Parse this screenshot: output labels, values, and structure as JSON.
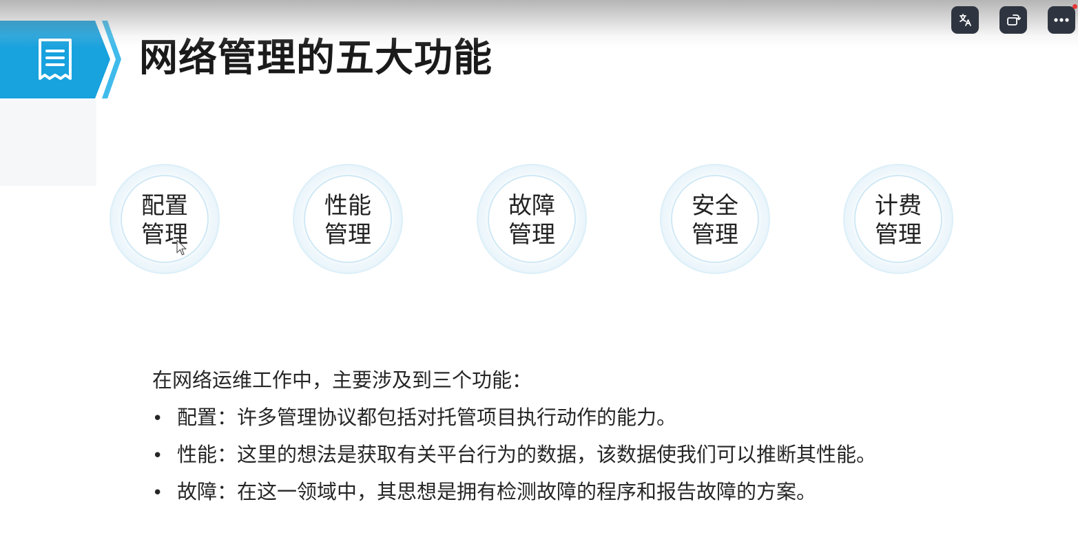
{
  "slide": {
    "title": "网络管理的五大功能",
    "banner_icon": "document-icon",
    "functions": [
      {
        "line1": "配置",
        "line2": "管理"
      },
      {
        "line1": "性能",
        "line2": "管理"
      },
      {
        "line1": "故障",
        "line2": "管理"
      },
      {
        "line1": "安全",
        "line2": "管理"
      },
      {
        "line1": "计费",
        "line2": "管理"
      }
    ],
    "intro": "在网络运维工作中，主要涉及到三个功能：",
    "bullets": [
      "配置：许多管理协议都包括对托管项目执行动作的能力。",
      "性能：这里的想法是获取有关平台行为的数据，该数据使我们可以推断其性能。",
      "故障：在这一领域中，其思想是拥有检测故障的程序和报告故障的方案。"
    ],
    "bullet_symbol": "•"
  },
  "player_controls": [
    {
      "icon": "subtitle-translate-icon"
    },
    {
      "icon": "rotate-screen-icon"
    },
    {
      "icon": "more-options-icon"
    }
  ],
  "colors": {
    "banner_blue": "#1aa0dc",
    "banner_light": "#3fbbeb",
    "title_text": "#1a1a1a",
    "body_text": "#262626",
    "circle_ring": "#cfe8f5",
    "player_button": "#2f3540",
    "notification_dot": "#e53935"
  }
}
